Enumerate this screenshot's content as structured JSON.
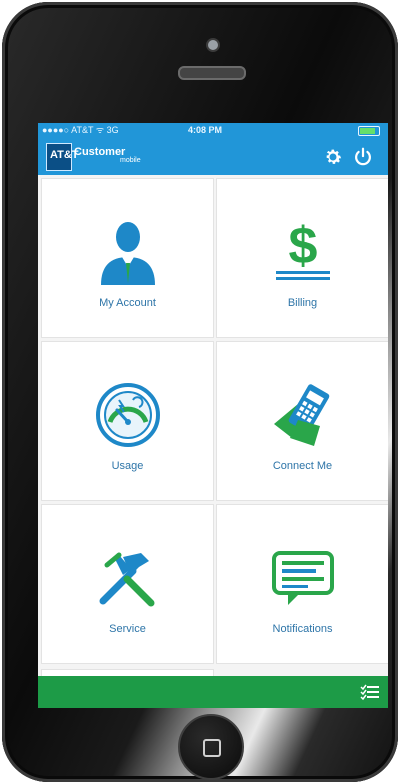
{
  "status_bar": {
    "carrier": "●●●●○ AT&T ᯤ 3G",
    "time": "4:08 PM"
  },
  "header": {
    "logo_text": "AT&T",
    "logo_word": "Customer",
    "logo_sub": "mobile"
  },
  "tiles": [
    {
      "label": "My Account",
      "icon": "person-icon"
    },
    {
      "label": "Billing",
      "icon": "dollar-icon"
    },
    {
      "label": "Usage",
      "icon": "gauge-icon"
    },
    {
      "label": "Connect Me",
      "icon": "phone-hand-icon"
    },
    {
      "label": "Service",
      "icon": "tools-icon"
    },
    {
      "label": "Notifications",
      "icon": "chat-icon"
    }
  ],
  "colors": {
    "accent": "#2196d8",
    "bottom_bar": "#1d9b47",
    "icon_green": "#2aa64a",
    "icon_blue": "#1e88c8"
  }
}
